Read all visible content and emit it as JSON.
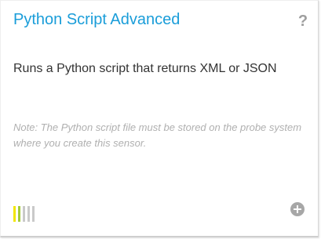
{
  "card": {
    "title": "Python Script Advanced",
    "help_icon_label": "?",
    "description": "Runs a Python script that returns XML or JSON",
    "note": "Note: The Python script file must be stored on the probe system where you create this sensor.",
    "performance_bars": [
      {
        "color": "#f2e600"
      },
      {
        "color": "#a3cb3a"
      },
      {
        "color": "#c9c9c9"
      },
      {
        "color": "#c9c9c9"
      },
      {
        "color": "#c9c9c9"
      }
    ],
    "add_icon": "add-circle-icon"
  },
  "colors": {
    "title": "#1a9dd9",
    "text": "#333333",
    "note": "#b0b0b0",
    "icon": "#a7a7a7"
  }
}
